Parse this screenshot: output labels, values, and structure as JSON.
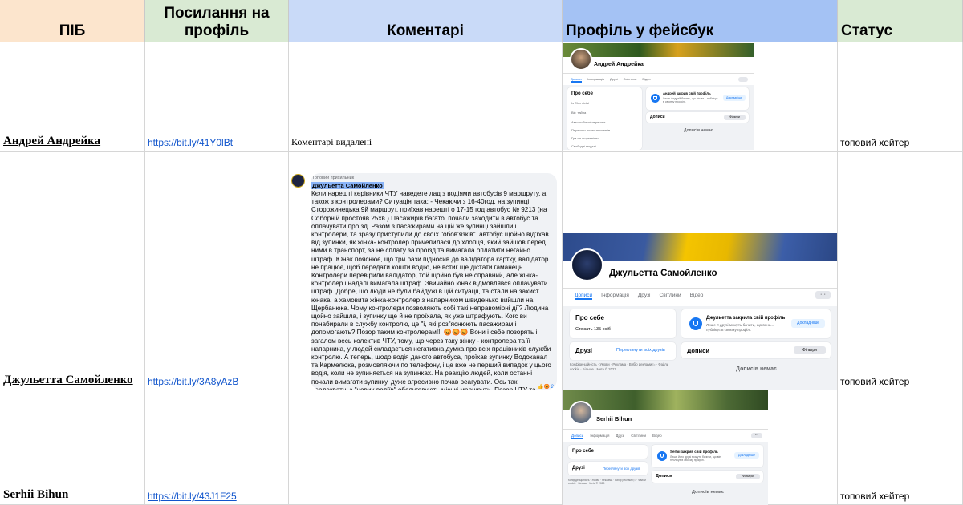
{
  "headers": {
    "name": "ПІБ",
    "profile_link": "Посилання на профіль",
    "comments": "Коментарі",
    "facebook_profile": "Профіль у фейсбук",
    "status": "Статус"
  },
  "rows": [
    {
      "name": "Андрей Андрейка",
      "link": "https://bit.ly/41Y0lBt",
      "comment": "Коментарі видалені",
      "status": "топовий хейтер",
      "fb": {
        "name": "Андрей Андрейка",
        "tabs": [
          "Дописи",
          "Інформація",
          "Друзі",
          "Світлини",
          "Відео"
        ],
        "about_title": "Про себе",
        "about_items": [
          "Із Chernivtsi",
          "Вік: тайна",
          "Автомобільні перегони",
          "Перегони позашляховиків",
          "Гра на фортепіано",
          "Свободні моделі"
        ],
        "locked_title": "Андрей закрив свій профіль",
        "locked_text": "Лише Андрей бачить, що він ви... публікує в своєму профілі.",
        "locked_button": "Докладніше",
        "posts_title": "Дописи",
        "filters_button": "Фільтри",
        "no_posts": "Дописів немає",
        "more": "···"
      }
    },
    {
      "name": "Джульетта Самойленко",
      "link": "https://bit.ly/3A8yAzB",
      "status": "топовий хейтер",
      "comment_block": {
        "badge": "Топовий прихильник",
        "author": "Джульетта Самойленко",
        "text": "Кєли нарешті керівники ЧТУ наведете лад з водіями автобусів 9 маршруту, а також з контролерами? Ситуація така: - Чекаючи з 16-40год. на зупинці Сторожинецька 9й маршрут, приїхав нарешті о 17-15 год автобус № 9213 (на Соборній простояв 25хв.) Пасажирів багато. почали заходити в автобус та оплачувати проїзд. Разом з пасажирами на цій же зупинці зайшли і контролери, та зразу приступили до своїх \"обов'язків\". автобус щойно від'їхав від зупинки, як жінка- контролер причепилася до хлопця, який зайшов перед ними в транспорт, за не сплату за проїзд та вимагала оплатити негайно штраф. Юнак пояснює, що три рази підносив до валідатора картку, валідатор не працює, щоб передати кошти водію, не встиг ще дістати гаманець. Контролери перевірили валідатор, той щойно був не справний, але жінка-контролер і надалі вимагала штраф. Звичайно юнак відмовлявся оплачувати штраф. Добре, що люди не були байдужі в цій ситуації, та стали на захист юнака, а хамовита жінка-контролер з напарником швиденько вийшли на Щербанюка. Чому контролери позволяють собі такі неправомірні дії? Людина щойно зайшла, і зупинку ще й не проїхала, як уже штрафують. Когс ви понабирали в службу контролю, це \"і, які роз\"яснюють пасажирам і допомогають? Позор таким контролерам!!! 😡😡😡 Вони і себе позорять і загалом весь колектив ЧТУ, тому, що через таку жінку - контролера та її напарника, у людей складається негативна думка про всіх працівників служби контролю. А теперь, щодо водія даного автобуса, проїхав зупинку Водоканал та Кармелюка, розмовляючи по телефону, і це вже не перший випадок у цього водія, коли не зупиняється на зупинках. На реакцію людей, коли останні почали вимагати зупинку, дуже агресивно почав реагувати. Ось такі неадекватні з \"нових водіїв\" обслуговують міські маршрути. Позор ЧТУ та таким працівникам!!!",
        "reactions": "👍😡 2"
      },
      "fb": {
        "name": "Джульетта Самойленко",
        "tabs": [
          "Дописи",
          "Інформація",
          "Друзі",
          "Світлини",
          "Відео"
        ],
        "about_title": "Про себе",
        "about_items": [
          "Стежать 135 осіб"
        ],
        "friends_title": "Друзі",
        "friends_link": "Переглянути всіх друзів",
        "locked_title": "Джульетта закрила свій профіль",
        "locked_text": "Лише її друзі можуть бачити, що вона... публікує в своєму профілі.",
        "locked_button": "Докладніше",
        "posts_title": "Дописи",
        "filters_button": "Фільтри",
        "no_posts": "Дописів немає",
        "footer": "Конфіденційність · Умови · Реклама · Вибір реклами ▷ · Файли cookie · Більше · Meta © 2023",
        "more": "···"
      }
    },
    {
      "name": "Serhii Bihun",
      "link": "https://bit.ly/43J1F25",
      "comment": "",
      "status": "топовий хейтер",
      "fb": {
        "name": "Serhii Bihun",
        "tabs": [
          "Дописи",
          "Інформація",
          "Друзі",
          "Світлини",
          "Відео"
        ],
        "about_title": "Про себе",
        "friends_title": "Друзі",
        "friends_link": "Переглянути всіх друзів",
        "locked_title": "Serhii закрив свій профіль",
        "locked_text": "Лише його друзі можуть бачити, що він публікує в своєму профілі.",
        "locked_button": "Докладніше",
        "posts_title": "Дописи",
        "filters_button": "Фільтри",
        "no_posts": "Дописів немає",
        "footer": "Конфіденційність · Умови · Реклама · Вибір реклами ▷ · Файли cookie · Більше · Meta © 2023",
        "more": "···"
      }
    }
  ],
  "colors": {
    "header_name": "#fce5cd",
    "header_link": "#d9ead3",
    "header_comments": "#c9daf8",
    "header_facebook": "#a4c2f4",
    "header_status": "#d9ead3",
    "link": "#1155cc",
    "fb_blue": "#1877f2"
  }
}
